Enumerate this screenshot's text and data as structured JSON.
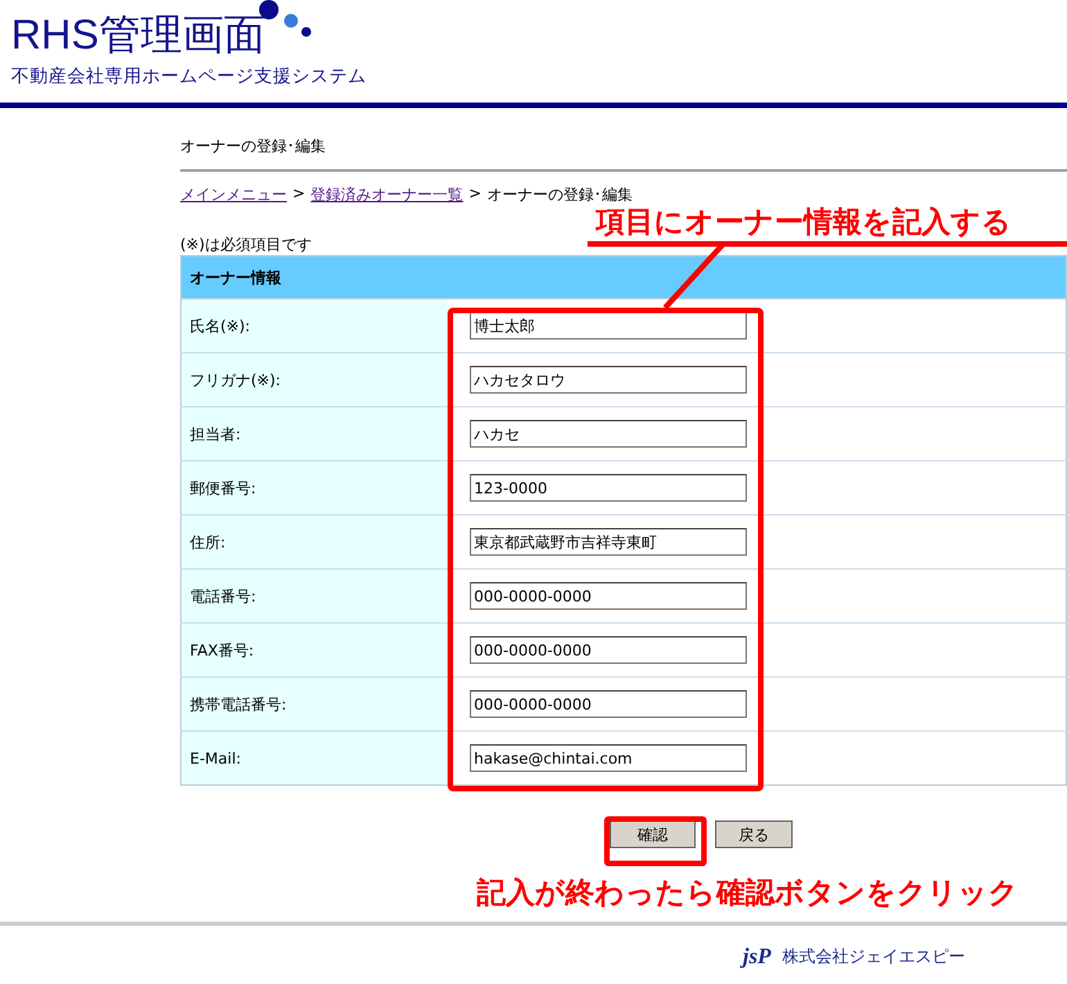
{
  "header": {
    "title": "RHS管理画面",
    "subtitle": "不動産会社専用ホームページ支援システム"
  },
  "page_title": "オーナーの登録･編集",
  "breadcrumb_separator": ">",
  "breadcrumb": [
    {
      "label": "メインメニュー",
      "link": true
    },
    {
      "label": "登録済みオーナー一覧",
      "link": true
    },
    {
      "label": "オーナーの登録･編集",
      "link": false
    }
  ],
  "note": "(※)は必須項目です",
  "form": {
    "heading": "オーナー情報",
    "fields": [
      {
        "label": "氏名(※):",
        "value": "博士太郎"
      },
      {
        "label": "フリガナ(※):",
        "value": "ハカセタロウ"
      },
      {
        "label": "担当者:",
        "value": "ハカセ"
      },
      {
        "label": "郵便番号:",
        "value": "123-0000"
      },
      {
        "label": "住所:",
        "value": "東京都武蔵野市吉祥寺東町"
      },
      {
        "label": "電話番号:",
        "value": "000-0000-0000"
      },
      {
        "label": "FAX番号:",
        "value": "000-0000-0000"
      },
      {
        "label": "携帯電話番号:",
        "value": "000-0000-0000"
      },
      {
        "label": "E-Mail:",
        "value": "hakase@chintai.com"
      }
    ]
  },
  "buttons": [
    {
      "label": "確認",
      "highlighted": true
    },
    {
      "label": "戻る",
      "highlighted": false
    }
  ],
  "annotations": {
    "fields_callout": "項目にオーナー情報を記入する",
    "button_callout": "記入が終わったら確認ボタンをクリック"
  },
  "footer": {
    "logo": "jsP",
    "company": "株式会社ジェイエスピー"
  }
}
